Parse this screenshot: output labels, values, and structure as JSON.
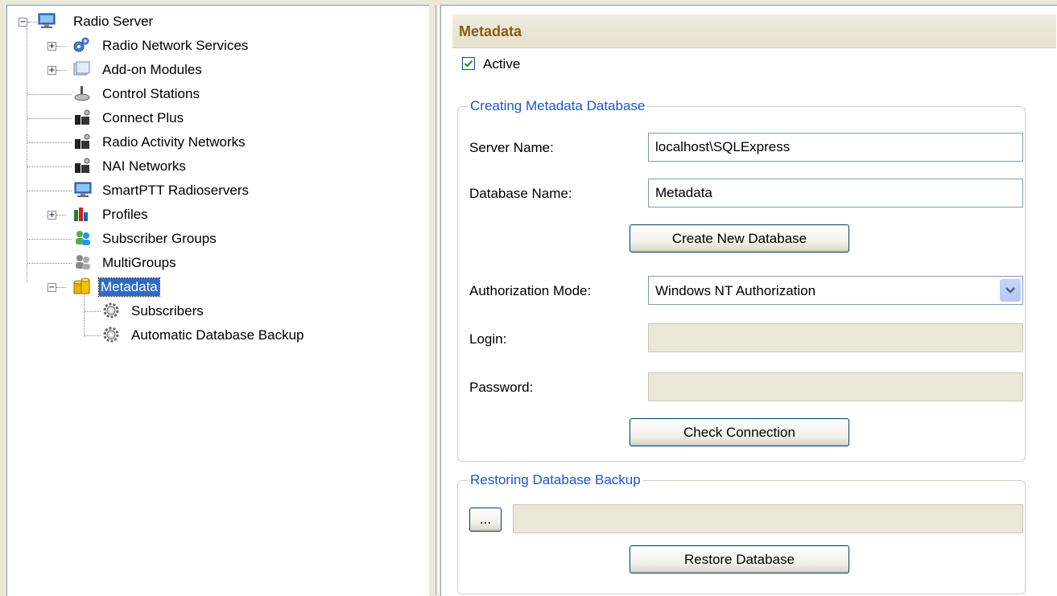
{
  "tree": {
    "root": {
      "label": "Radio Server",
      "icon": "monitor-icon"
    },
    "items": [
      {
        "label": "Radio Network Services",
        "icon": "network-services-icon",
        "expandable": true
      },
      {
        "label": "Add-on Modules",
        "icon": "modules-icon",
        "expandable": true
      },
      {
        "label": "Control Stations",
        "icon": "control-station-icon",
        "expandable": false
      },
      {
        "label": "Connect Plus",
        "icon": "radio-network-icon",
        "expandable": false
      },
      {
        "label": "Radio Activity Networks",
        "icon": "radio-network-icon",
        "expandable": false
      },
      {
        "label": "NAI Networks",
        "icon": "radio-network-icon",
        "expandable": false
      },
      {
        "label": "SmartPTT Radioservers",
        "icon": "monitor-icon",
        "expandable": false
      },
      {
        "label": "Profiles",
        "icon": "profiles-icon",
        "expandable": true
      },
      {
        "label": "Subscriber Groups",
        "icon": "subscriber-groups-icon",
        "expandable": false
      },
      {
        "label": "MultiGroups",
        "icon": "multigroups-icon",
        "expandable": false
      },
      {
        "label": "Metadata",
        "icon": "database-icon",
        "expandable": true,
        "expanded": true,
        "selected": true
      }
    ],
    "metadata_children": [
      {
        "label": "Subscribers",
        "icon": "gear-icon"
      },
      {
        "label": "Automatic Database Backup",
        "icon": "gear-icon"
      }
    ]
  },
  "panel": {
    "title": "Metadata",
    "active_label": "Active",
    "active_checked": true,
    "create_group": {
      "title": "Creating Metadata Database",
      "server_name_label": "Server Name:",
      "server_name_value": "localhost\\SQLExpress",
      "database_name_label": "Database Name:",
      "database_name_value": "Metadata",
      "create_button": "Create New Database",
      "auth_mode_label": "Authorization Mode:",
      "auth_mode_value": "Windows NT Authorization",
      "login_label": "Login:",
      "login_value": "",
      "password_label": "Password:",
      "password_value": "",
      "check_button": "Check Connection"
    },
    "restore_group": {
      "title": "Restoring Database Backup",
      "browse_button": "...",
      "path_value": "",
      "restore_button": "Restore Database"
    }
  }
}
